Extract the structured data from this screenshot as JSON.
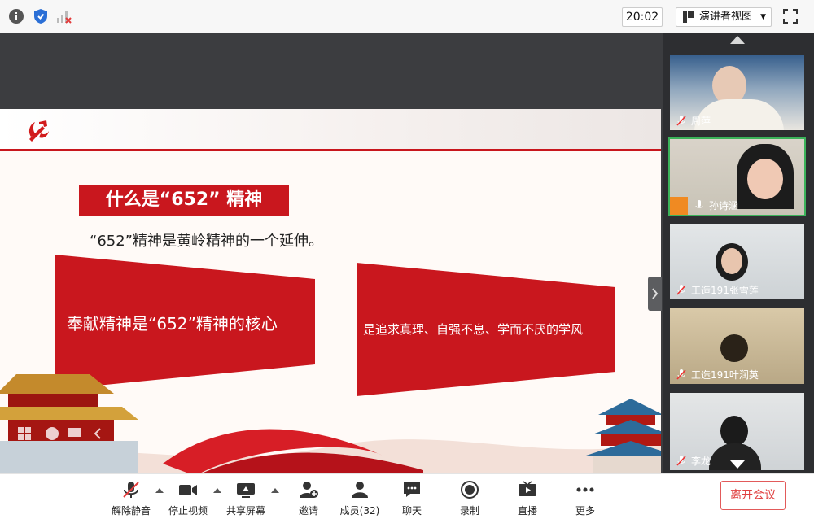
{
  "topbar": {
    "time": "20:02",
    "view_label": "演讲者视图",
    "icons": [
      "info-icon",
      "shield-icon",
      "signal-icon",
      "layout-icon",
      "fullscreen-icon"
    ]
  },
  "slide": {
    "title": "什么是“652” 精神",
    "subtitle": "“652”精神是黄岭精神的一个延伸。",
    "card_left": "奉献精神是“652”精神的核心",
    "card_right": "是追求真理、自强不息、学而不厌的学风",
    "accent_color": "#c9171e"
  },
  "participants": [
    {
      "name": "周萍",
      "muted": true
    },
    {
      "name": "孙诗涵",
      "muted": false,
      "active": true
    },
    {
      "name": "工造191张雪莲",
      "muted": true
    },
    {
      "name": "工造191叶润英",
      "muted": true
    },
    {
      "name": "李龙",
      "muted": true
    }
  ],
  "toolbar": {
    "unmute": "解除静音",
    "stop_video": "停止视频",
    "share_screen": "共享屏幕",
    "invite": "邀请",
    "members": "成员(32)",
    "chat": "聊天",
    "record": "录制",
    "live": "直播",
    "more": "更多",
    "leave": "离开会议"
  }
}
